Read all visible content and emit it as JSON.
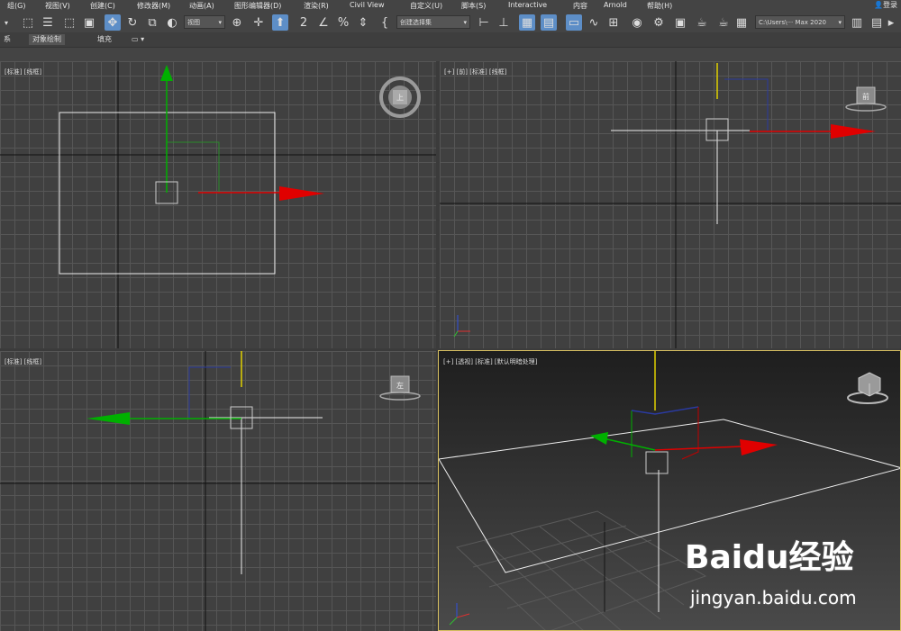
{
  "menubar": {
    "items": [
      "组(G)",
      "视图(V)",
      "创建(C)",
      "修改器(M)",
      "动画(A)",
      "图形编辑器(D)",
      "渲染(R)",
      "Civil View",
      "自定义(U)",
      "脚本(S)",
      "Interactive",
      "内容",
      "Arnold",
      "帮助(H)"
    ],
    "login": "登录"
  },
  "toolbar": {
    "view_dropdown": "视图",
    "selection_set_dropdown": "创建选择集",
    "path_dropdown": "C:\\Users\\··· Max 2020"
  },
  "ribbon": {
    "tabs": [
      "对象绘制",
      "填充"
    ],
    "left_fragment": "系"
  },
  "viewports": {
    "top": {
      "label": "[标准] [线框]",
      "cube": "上"
    },
    "front": {
      "label": "[+] [前] [标准] [线框]",
      "cube": "前"
    },
    "left": {
      "label": "[标准] [线框]",
      "cube": "左"
    },
    "perspective": {
      "label": "[+] [透视] [标准] [默认明暗处理]"
    }
  },
  "watermark": {
    "logo": "Baidu经验",
    "url": "jingyan.baidu.com"
  },
  "colors": {
    "active_tool": "#5d8ec7",
    "active_viewport_border": "#d8c060",
    "x_axis": "#e00000",
    "y_axis": "#00b000",
    "z_axis": "#e0d000"
  }
}
